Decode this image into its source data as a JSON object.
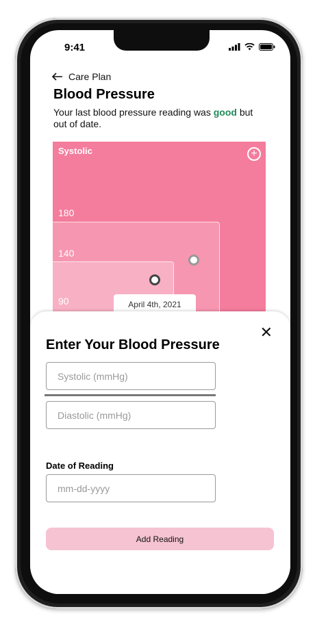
{
  "status_bar": {
    "time": "9:41"
  },
  "nav": {
    "back_label": "Care Plan"
  },
  "page": {
    "title": "Blood Pressure",
    "summary_prefix": "Your last blood pressure reading was ",
    "summary_status": "good",
    "summary_suffix": " but out of date."
  },
  "chart": {
    "title": "Systolic",
    "ticks": [
      "180",
      "140",
      "90"
    ],
    "tooltip": "April 4th, 2021"
  },
  "sheet": {
    "title": "Enter Your Blood Pressure",
    "systolic_placeholder": "Systolic (mmHg)",
    "diastolic_placeholder": "Diastolic (mmHg)",
    "date_label": "Date of Reading",
    "date_placeholder": "mm-dd-yyyy",
    "submit_label": "Add Reading"
  },
  "colors": {
    "chart": "#f47c9d",
    "good": "#1f8a5b",
    "button": "#f5c3d1"
  }
}
